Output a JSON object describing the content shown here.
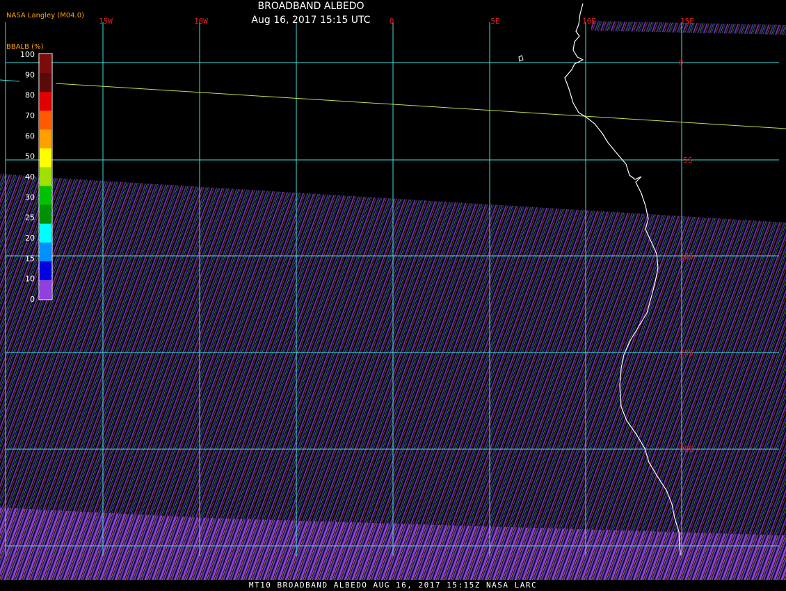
{
  "header": {
    "title": "BROADBAND ALBEDO",
    "timestamp": "Aug 16, 2017 15:15 UTC",
    "source": "NASA Langley (M04.0)"
  },
  "legend": {
    "label": "BBALB (%)",
    "ticks": [
      "100",
      "90",
      "80",
      "70",
      "60",
      "50",
      "40",
      "30",
      "25",
      "20",
      "15",
      "10",
      "0"
    ],
    "colors": [
      "#7a0c0c",
      "#5a0a0a",
      "#e00000",
      "#ff5a00",
      "#ffa000",
      "#ffff00",
      "#a0e000",
      "#00c000",
      "#009000",
      "#00ffff",
      "#0090ff",
      "#0000e0",
      "#9040e0"
    ]
  },
  "map": {
    "lon_labels": [
      "15W",
      "10W",
      "0",
      "5E",
      "10E",
      "15E"
    ],
    "lat_labels": [
      "0",
      "5S",
      "10S",
      "15S",
      "20S"
    ],
    "grid_color": "#40e0e0",
    "label_color": "#e02020",
    "coast_color": "#ffffff"
  },
  "footer": {
    "text": "MT10  BROADBAND ALBEDO  AUG 16, 2017 15:15Z  NASA LARC"
  }
}
